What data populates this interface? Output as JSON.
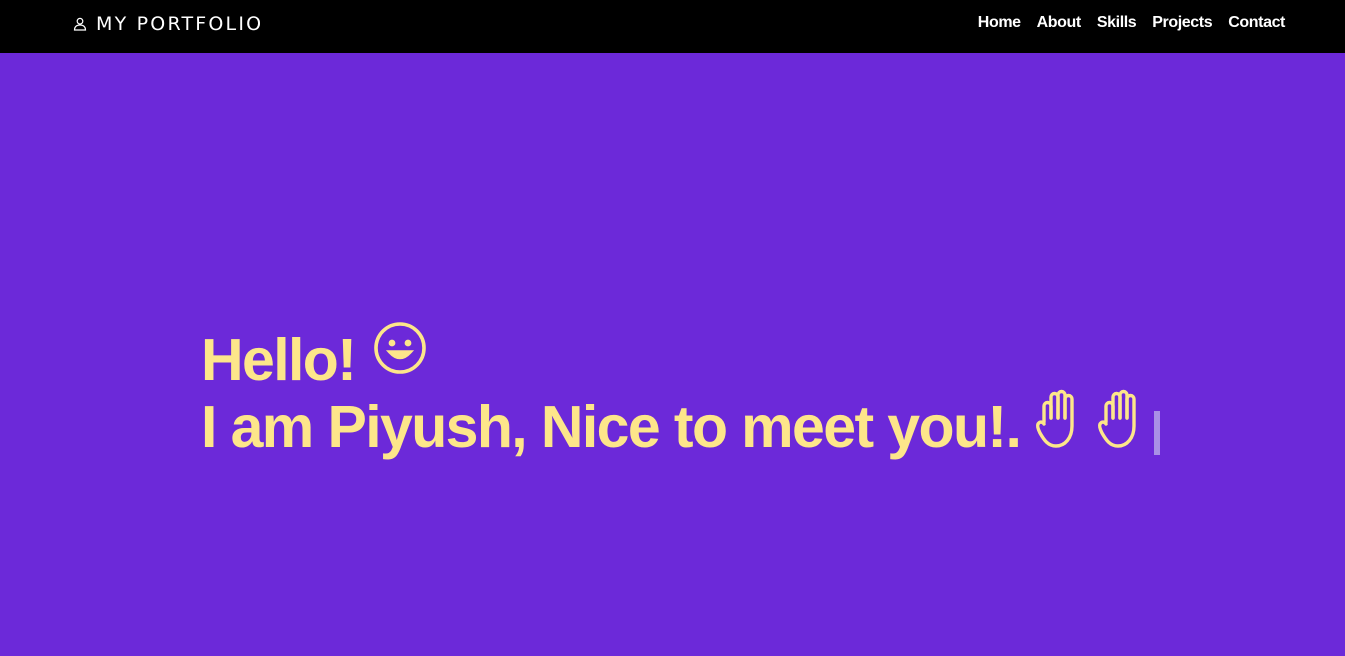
{
  "nav": {
    "brand": "MY PORTFOLIO",
    "brand_icon": "user-icon",
    "links": [
      "Home",
      "About",
      "Skills",
      "Projects",
      "Contact"
    ]
  },
  "hero": {
    "greeting": "Hello!",
    "greeting_icon": "smile-icon",
    "intro": "I am Piyush, Nice to meet you!.",
    "intro_icons": [
      "raised-hand-icon",
      "raised-hand-icon"
    ],
    "typing_cursor": true
  },
  "colors": {
    "navbar_bg": "#000000",
    "hero_bg": "#6c29d9",
    "hero_text": "#fde68a",
    "nav_text": "#ffffff",
    "cursor": "#a990e6"
  }
}
